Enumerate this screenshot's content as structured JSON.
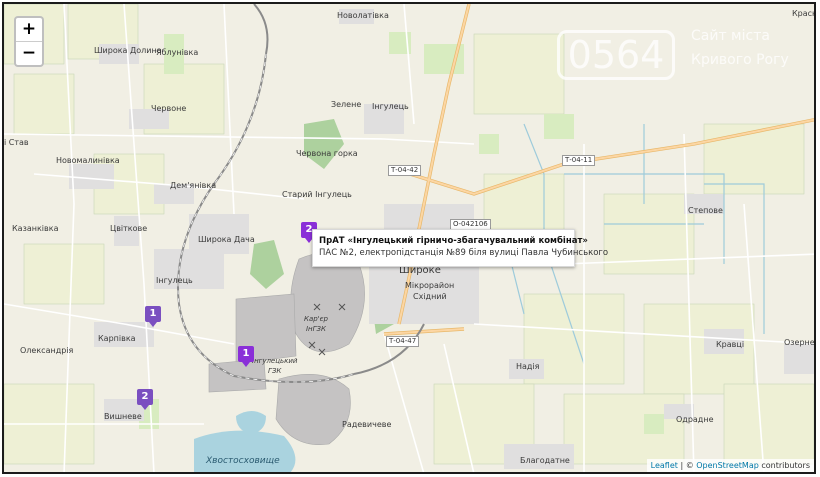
{
  "zoom": {
    "in_label": "+",
    "out_label": "−"
  },
  "places": {
    "novolativka": "Новолатівка",
    "shyroka_dolyna": "Широка Долина",
    "yablunivka": "Яблунівка",
    "chervone": "Червоне",
    "zelene": "Зелене",
    "inhulets_n": "Інгулець",
    "i_stav": "і Став",
    "novomalynivka": "Новомалинівка",
    "chervona_hirka": "Червона горка",
    "demyanivka": "Дем'янівка",
    "staryi_inhulets": "Старий Інгулець",
    "kazankivka": "Казанківка",
    "tsvitkove": "Цвіткове",
    "shyroka_dacha": "Широка Дача",
    "inhulets_w": "Інгулець",
    "shyroke": "Широке",
    "mikroraion": "Мікрорайон",
    "skhidnyi": "Східний",
    "kariakha": "Кар'єр\nІнГЗК",
    "karpivka": "Карпівка",
    "oleksandriia": "Олександрія",
    "inhulets_gzk": "Інгулецький\nГЗК",
    "vyshneve": "Вишневе",
    "nadiia": "Надія",
    "radevycheve": "Радевичеве",
    "khvostoskhovyshche": "Хвостосховище",
    "blahodatne": "Благодатне",
    "stepove": "Степове",
    "kravtsi": "Кравці",
    "ozerne": "Озерне",
    "odradne": "Одрадне",
    "krasni": "Красни"
  },
  "roads": {
    "t0442": "Т-04-42",
    "t0411": "Т-04-11",
    "o042106": "О-042106",
    "t0447": "Т-04-47"
  },
  "markers": [
    {
      "label": "2",
      "color": "#8a2fd8"
    },
    {
      "label": "1",
      "color": "#7a4fc0"
    },
    {
      "label": "1",
      "color": "#8a2fd8"
    },
    {
      "label": "2",
      "color": "#7a4fc0"
    }
  ],
  "popup": {
    "title": "ПрАТ «Інгулецький гірничо-збагачувальний комбінат»",
    "address": "ПАС №2, електропідстанція №89 біля вулиці Павла Чубинського"
  },
  "watermark": {
    "number": "0564",
    "line1": "Сайт міста",
    "line2": "Кривого Рогу"
  },
  "attribution": {
    "leaflet": "Leaflet",
    "separator": "|",
    "copyright": "©",
    "osm": "OpenStreetMap",
    "contributors": "contributors"
  },
  "colors": {
    "land": "#f1efe4",
    "farmland": "#eef0d5",
    "meadow": "#d8ecc0",
    "forest": "#add19e",
    "residential": "#e0dfdf",
    "quarry": "#c5c3c3",
    "water": "#aad3df",
    "primary_road": "#fcd6a4",
    "railway": "#8a8a8a",
    "marker_purple": "#8a2fd8"
  }
}
